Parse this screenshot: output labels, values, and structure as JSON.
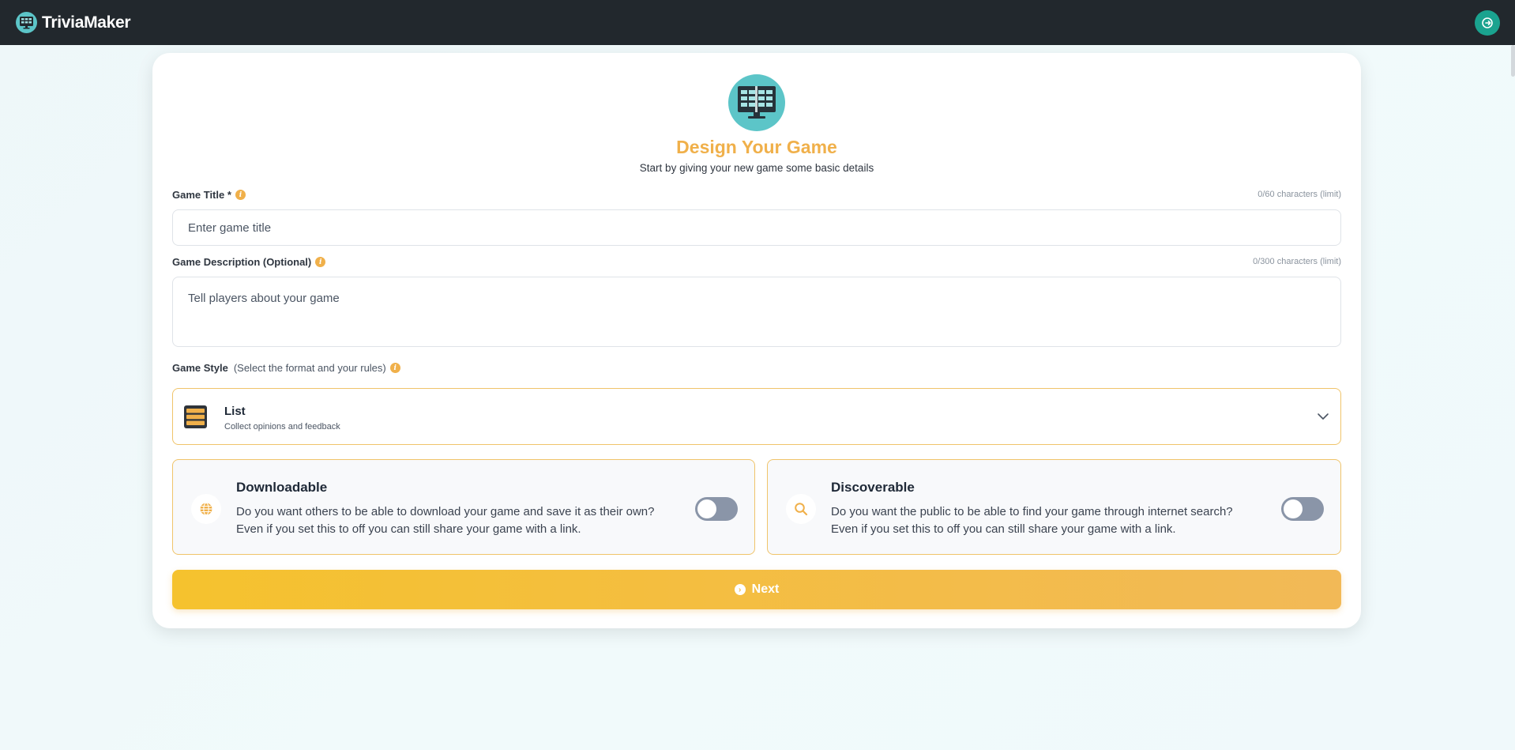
{
  "navbar": {
    "brand_name": "TriviaMaker",
    "logo_icon": "tv-grid-icon",
    "logout_icon": "logout-icon"
  },
  "hero": {
    "icon": "tv-grid-icon",
    "title": "Design Your Game",
    "subtitle": "Start by giving your new game some basic details"
  },
  "form": {
    "title_field": {
      "label": "Game Title *",
      "limit": "0/60 characters (limit)",
      "placeholder": "Enter game title",
      "value": ""
    },
    "description_field": {
      "label": "Game Description (Optional)",
      "limit": "0/300 characters (limit)",
      "placeholder": "Tell players about your game",
      "value": ""
    },
    "style_field": {
      "label": "Game Style",
      "hint": "(Select the format and your rules)",
      "selected_name": "List",
      "selected_desc": "Collect opinions and feedback",
      "icon": "list-icon"
    },
    "options": [
      {
        "title": "Downloadable",
        "desc_line1": "Do you want others to be able to download your game and save it as their own?",
        "desc_line2": "Even if you set this to off you can still share your game with a link.",
        "icon": "globe-icon",
        "enabled": false
      },
      {
        "title": "Discoverable",
        "desc_line1": "Do you want the public to be able to find your game through internet search?",
        "desc_line2": "Even if you set this to off you can still share your game with a link.",
        "icon": "search-icon",
        "enabled": false
      }
    ],
    "next_label": "Next"
  },
  "colors": {
    "navbar": "#22282d",
    "accent": "#f0b04a",
    "teal": "#5cc5c8",
    "logout": "#1aa38f",
    "toggle_off": "#8a95a8"
  }
}
